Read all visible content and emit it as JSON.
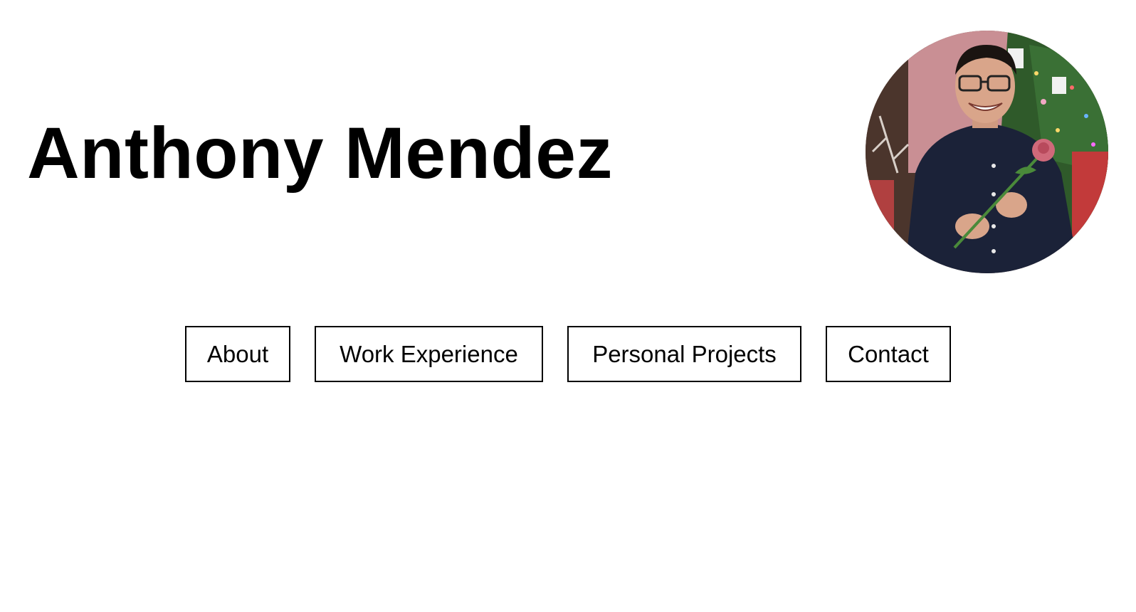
{
  "header": {
    "name": "Anthony Mendez"
  },
  "profile_photo": {
    "icon": "profile-photo",
    "colors": {
      "background_tree": "#2f5a2a",
      "shirt": "#1b2238",
      "skin": "#d9a58a",
      "hair": "#1a1411",
      "rose": "#d0697a"
    }
  },
  "nav": {
    "items": [
      {
        "label": "About"
      },
      {
        "label": "Work Experience"
      },
      {
        "label": "Personal Projects"
      },
      {
        "label": "Contact"
      }
    ]
  }
}
